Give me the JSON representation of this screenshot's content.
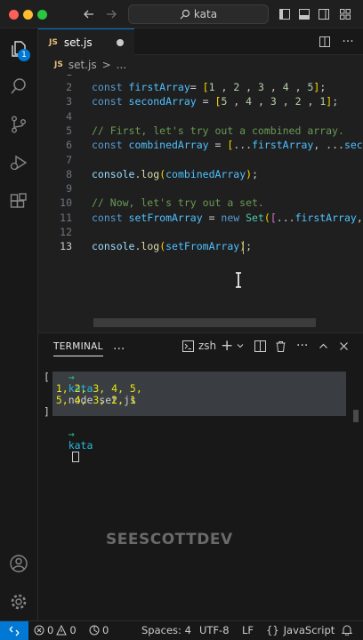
{
  "titlebar": {
    "search_text": "kata"
  },
  "activity": {
    "explorer_badge": "1"
  },
  "tab": {
    "icon_text": "JS",
    "filename": "set.js"
  },
  "breadcrumb": {
    "icon_text": "JS",
    "file": "set.js",
    "separator": ">",
    "more": "..."
  },
  "editor": {
    "lines": [
      {
        "n": "2",
        "tokens": [
          [
            "kw",
            "const "
          ],
          [
            "var",
            "firstArray"
          ],
          [
            "",
            "= "
          ],
          [
            "br1",
            "["
          ],
          [
            "num",
            "1"
          ],
          [
            "",
            " , "
          ],
          [
            "num",
            "2"
          ],
          [
            "",
            " , "
          ],
          [
            "num",
            "3"
          ],
          [
            "",
            " , "
          ],
          [
            "num",
            "4"
          ],
          [
            "",
            " , "
          ],
          [
            "num",
            "5"
          ],
          [
            "br1",
            "]"
          ],
          [
            "",
            ";"
          ]
        ]
      },
      {
        "n": "3",
        "tokens": [
          [
            "kw",
            "const "
          ],
          [
            "var",
            "secondArray"
          ],
          [
            "",
            " = "
          ],
          [
            "br1",
            "["
          ],
          [
            "num",
            "5"
          ],
          [
            "",
            " , "
          ],
          [
            "num",
            "4"
          ],
          [
            "",
            " , "
          ],
          [
            "num",
            "3"
          ],
          [
            "",
            " , "
          ],
          [
            "num",
            "2"
          ],
          [
            "",
            " , "
          ],
          [
            "num",
            "1"
          ],
          [
            "br1",
            "]"
          ],
          [
            "",
            ";"
          ]
        ]
      },
      {
        "n": "4",
        "tokens": []
      },
      {
        "n": "5",
        "tokens": [
          [
            "cm",
            "// First, let's try out a combined array."
          ]
        ]
      },
      {
        "n": "6",
        "tokens": [
          [
            "kw",
            "const "
          ],
          [
            "var",
            "combinedArray"
          ],
          [
            "",
            " = "
          ],
          [
            "br1",
            "["
          ],
          [
            "",
            "..."
          ],
          [
            "var",
            "firstArray"
          ],
          [
            "",
            ", ..."
          ],
          [
            "var",
            "secondArray"
          ]
        ]
      },
      {
        "n": "7",
        "tokens": []
      },
      {
        "n": "8",
        "tokens": [
          [
            "prop",
            "console"
          ],
          [
            "",
            "."
          ],
          [
            "fn",
            "log"
          ],
          [
            "br1",
            "("
          ],
          [
            "var",
            "combinedArray"
          ],
          [
            "br1",
            ")"
          ],
          [
            "",
            ";"
          ]
        ]
      },
      {
        "n": "9",
        "tokens": []
      },
      {
        "n": "10",
        "tokens": [
          [
            "cm",
            "// Now, let's try out a set."
          ]
        ]
      },
      {
        "n": "11",
        "tokens": [
          [
            "kw",
            "const "
          ],
          [
            "var",
            "setFromArray"
          ],
          [
            "",
            " = "
          ],
          [
            "kw",
            "new "
          ],
          [
            "cls",
            "Set"
          ],
          [
            "br1",
            "("
          ],
          [
            "br2",
            "["
          ],
          [
            "",
            "..."
          ],
          [
            "var",
            "firstArray"
          ],
          [
            "",
            ", ..."
          ]
        ]
      },
      {
        "n": "12",
        "tokens": []
      },
      {
        "n": "13",
        "tokens": [
          [
            "prop",
            "console"
          ],
          [
            "",
            "."
          ],
          [
            "fn",
            "log"
          ],
          [
            "br1",
            "("
          ],
          [
            "var",
            "setFromArray"
          ],
          [
            "br1",
            ")"
          ],
          [
            "",
            ";"
          ]
        ]
      }
    ]
  },
  "terminal": {
    "tab_label": "TERMINAL",
    "more": "...",
    "shell": "zsh",
    "prompt_arrow": "→",
    "prompt_dir": "kata",
    "command": "node set.js",
    "output": [
      "[",
      "  1, 2, 3, 4, 5,",
      "  5, 4, 3, 2, 1",
      "]"
    ],
    "watermark": "SEESCOTTDEV"
  },
  "status": {
    "errors": "0",
    "warnings": "0",
    "ports": "0",
    "spaces": "Spaces: 4",
    "encoding": "UTF-8",
    "eol": "LF",
    "language": "JavaScript"
  },
  "colors": {
    "accent": "#0078d4",
    "editor_bg": "#1f1f1f",
    "panel_bg": "#181818"
  }
}
